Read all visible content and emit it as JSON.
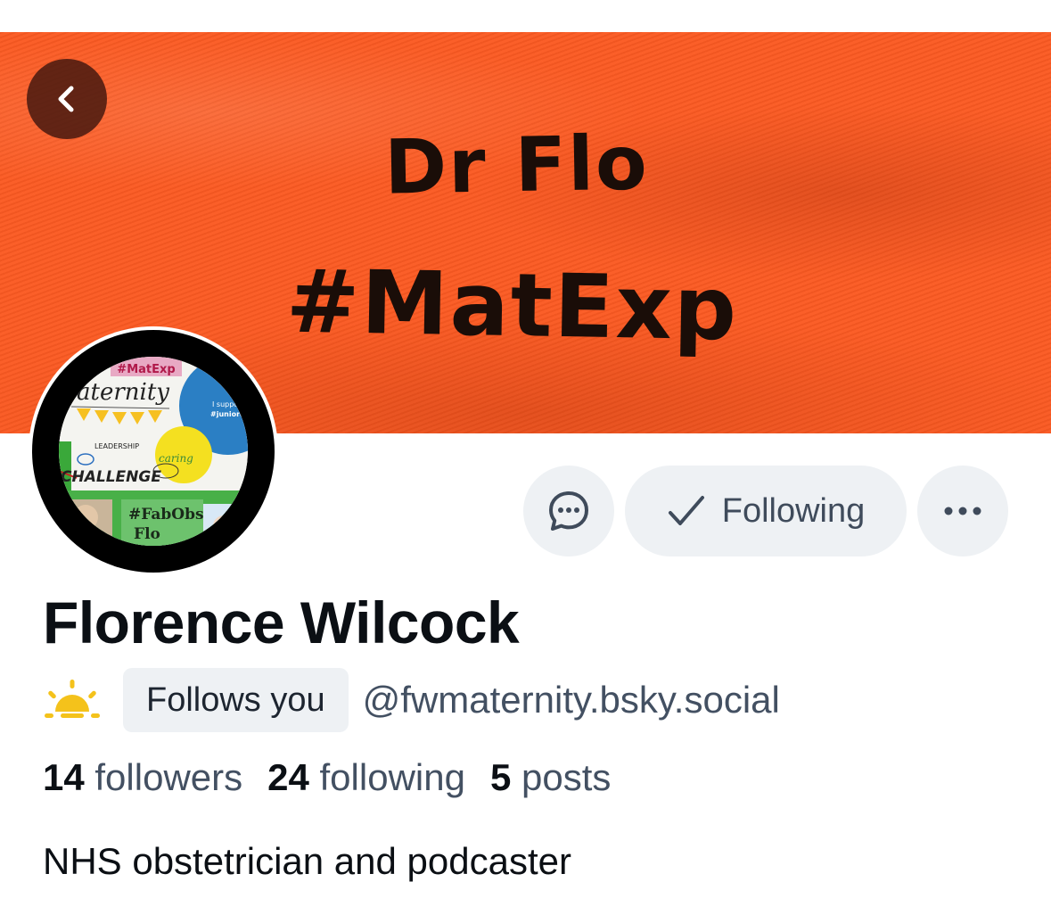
{
  "banner": {
    "line1": "Dr Flo",
    "line2": "#MatExp",
    "color": "#fb5a22"
  },
  "back_button": {
    "icon": "chevron-left-icon"
  },
  "avatar": {
    "texts": {
      "tag": "#MatExp",
      "title": "aternity",
      "support1": "I support",
      "support2": "#juniordoctors",
      "leadership": "LEADERSHIP",
      "challenge": "CHALLENGE",
      "caring": "caring",
      "fabobs": "#FabObs",
      "flo": "Flo"
    }
  },
  "actions": {
    "message_icon": "chat-bubble-icon",
    "following_label": "Following",
    "following_icon": "checkmark-icon",
    "more_icon": "ellipsis-icon"
  },
  "profile": {
    "display_name": "Florence Wilcock",
    "emoji_icon": "sun-icon",
    "follows_you": "Follows you",
    "handle": "@fwmaternity.bsky.social",
    "bio": "NHS obstetrician and podcaster"
  },
  "stats": {
    "followers_count": "14",
    "followers_label": "followers",
    "following_count": "24",
    "following_label": "following",
    "posts_count": "5",
    "posts_label": "posts"
  }
}
